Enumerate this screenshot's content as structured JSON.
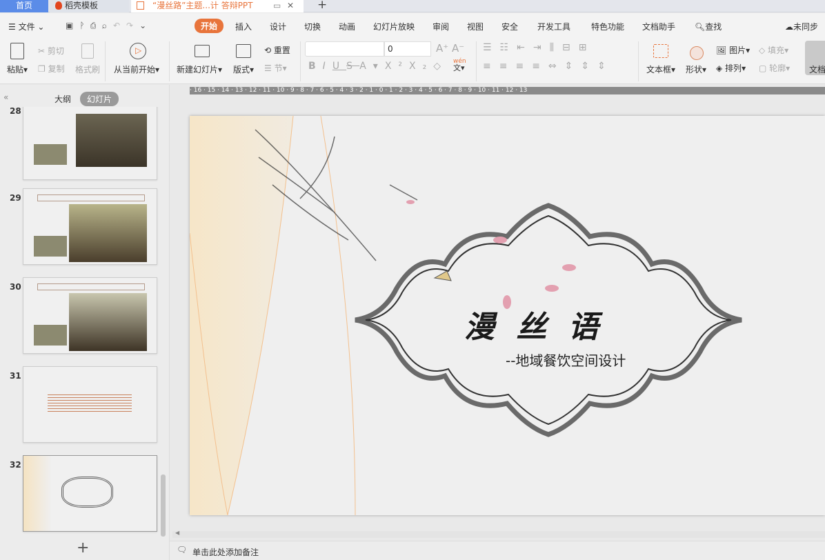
{
  "tabs": [
    {
      "label": "首页"
    },
    {
      "label": "稻壳模板"
    },
    {
      "label": "“漫丝路”主题...计 答辩PPT"
    }
  ],
  "menu": {
    "file": "文件",
    "items": [
      "开始",
      "插入",
      "设计",
      "切换",
      "动画",
      "幻灯片放映",
      "审阅",
      "视图",
      "安全",
      "开发工具",
      "特色功能",
      "文档助手"
    ],
    "search": "查找",
    "sync": "未同步"
  },
  "ribbon": {
    "paste": "粘贴",
    "cut": "剪切",
    "copy": "复制",
    "format_painter": "格式刷",
    "play_from_current": "从当前开始",
    "new_slide": "新建幻灯片",
    "layout": "版式",
    "reset": "重置",
    "section": "节",
    "font_size": "0",
    "pinyin": "wén",
    "text_box": "文本框",
    "shape": "形状",
    "picture": "图片",
    "arrange": "排列",
    "fill": "填充",
    "outline": "轮廓",
    "doc": "文档"
  },
  "panel": {
    "outline_tab": "大纲",
    "slides_tab": "幻灯片",
    "slides": [
      {
        "num": "28"
      },
      {
        "num": "29"
      },
      {
        "num": "30"
      },
      {
        "num": "31"
      },
      {
        "num": "32"
      }
    ]
  },
  "ruler": "· 16 · 15 · 14 · 13 · 12 · 11 · 10 · 9 · 8 · 7 · 6 · 5 · 4 · 3 · 2 · 1 · 0 · 1 · 2 · 3 · 4 · 5 · 6 · 7 · 8 · 9 · 10 · 11 · 12 · 13",
  "slide": {
    "title": "漫 丝 语",
    "subtitle": "--地域餐饮空间设计"
  },
  "notes": {
    "placeholder": "单击此处添加备注"
  },
  "colors": {
    "accent": "#e8743b",
    "home_tab": "#5b8ce8"
  }
}
